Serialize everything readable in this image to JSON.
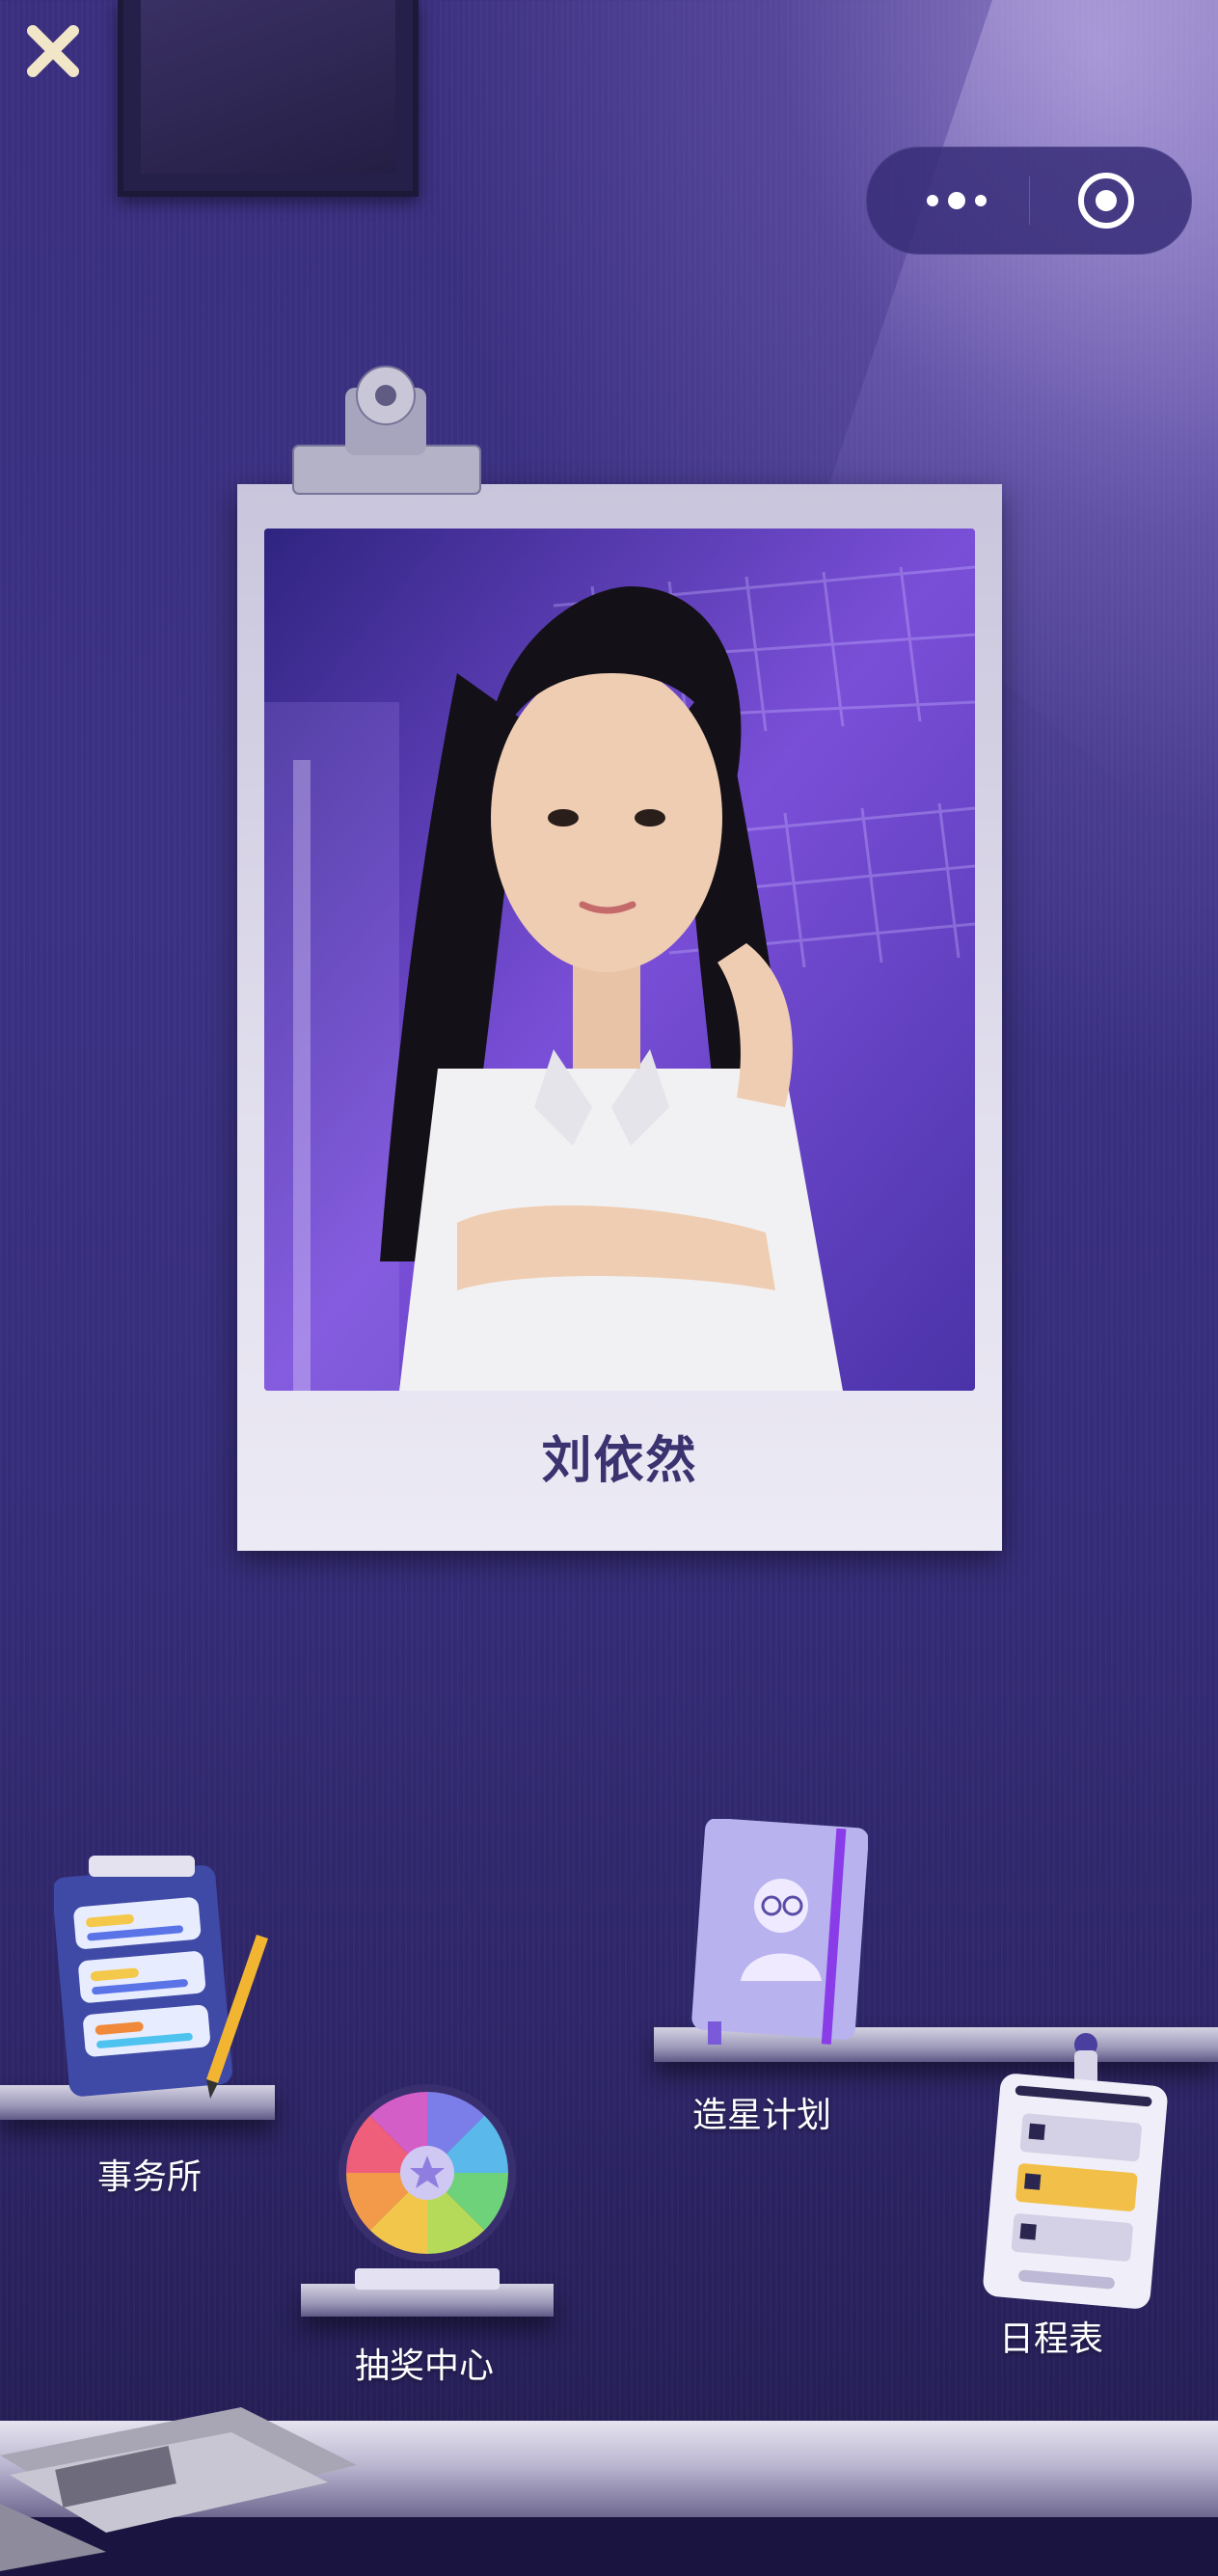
{
  "character": {
    "name": "刘依然"
  },
  "nav": {
    "close_icon": "close-icon",
    "more_icon": "more-dots-icon",
    "target_icon": "target-circle-icon"
  },
  "items": [
    {
      "id": "agency",
      "label": "事务所",
      "icon": "clipboard-icon"
    },
    {
      "id": "star-plan",
      "label": "造星计划",
      "icon": "notebook-icon"
    },
    {
      "id": "lottery",
      "label": "抽奖中心",
      "icon": "prize-wheel-icon"
    },
    {
      "id": "schedule",
      "label": "日程表",
      "icon": "schedule-card-icon"
    }
  ],
  "colors": {
    "background": "#3a2f7e",
    "accent": "#6a43c8",
    "name_text": "#3b3270",
    "label_text": "#ffffff"
  }
}
